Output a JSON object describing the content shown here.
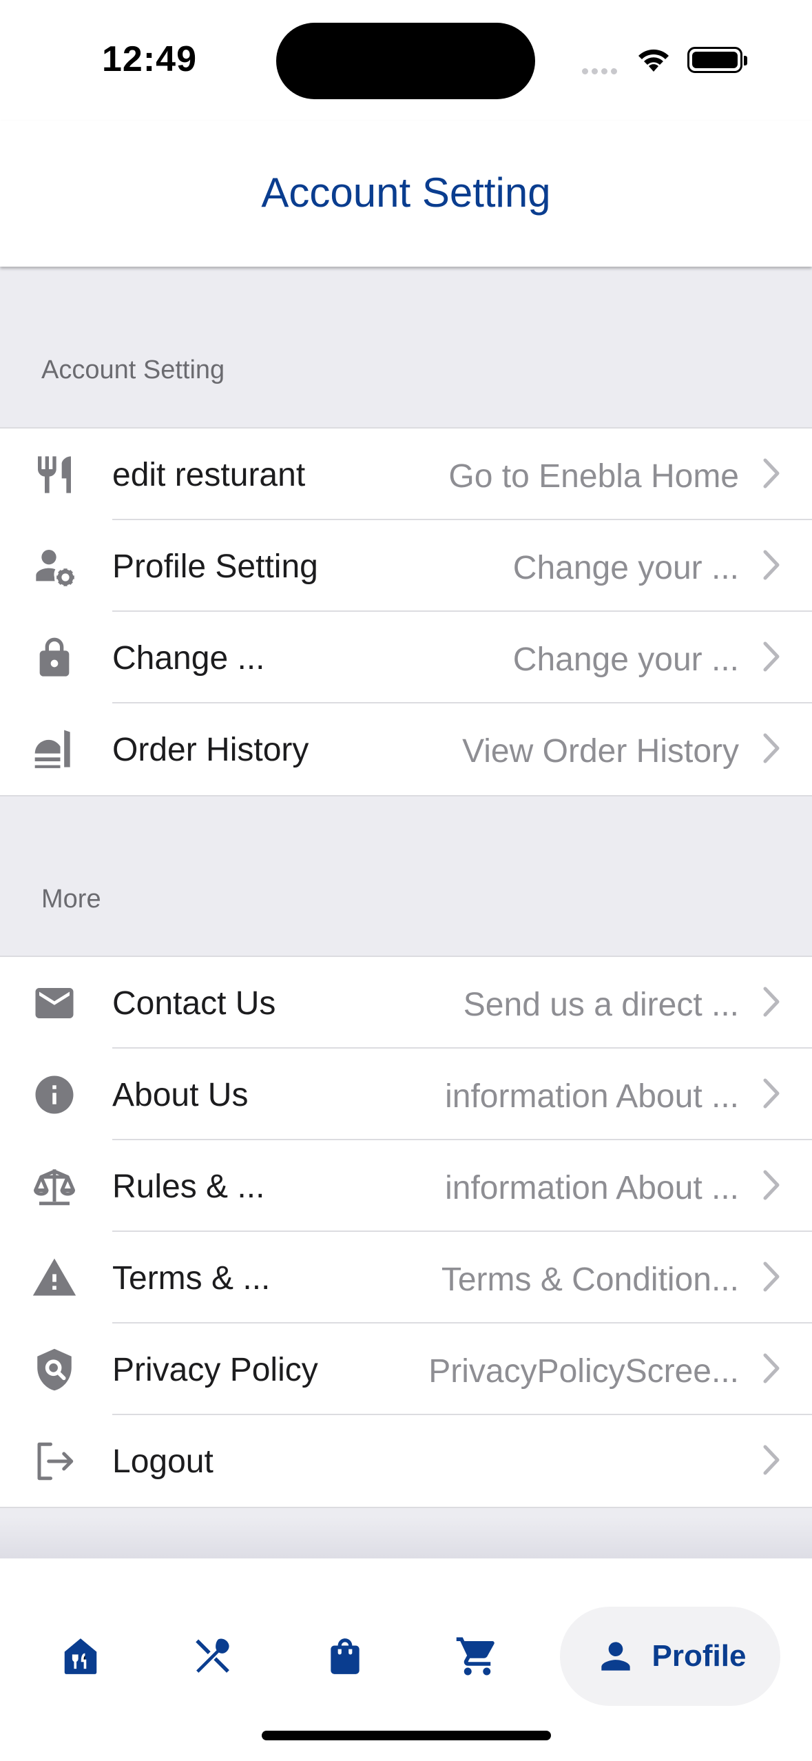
{
  "status_bar": {
    "time": "12:49"
  },
  "header": {
    "title": "Account Setting"
  },
  "sections": [
    {
      "title": "Account Setting",
      "items": [
        {
          "icon": "fork-knife-icon",
          "label": "edit resturant",
          "detail": "Go to Enebla Home"
        },
        {
          "icon": "user-gear-icon",
          "label": "Profile Setting",
          "detail": "Change your ..."
        },
        {
          "icon": "lock-icon",
          "label": "Change ...",
          "detail": "Change your ..."
        },
        {
          "icon": "food-bell-icon",
          "label": "Order History",
          "detail": "View Order History"
        }
      ]
    },
    {
      "title": "More",
      "items": [
        {
          "icon": "mail-icon",
          "label": "Contact Us",
          "detail": "Send us a direct ..."
        },
        {
          "icon": "info-icon",
          "label": "About Us",
          "detail": "information About ..."
        },
        {
          "icon": "scale-icon",
          "label": "Rules & ...",
          "detail": "information About ..."
        },
        {
          "icon": "warning-icon",
          "label": "Terms & ...",
          "detail": "Terms & Condition..."
        },
        {
          "icon": "shield-search-icon",
          "label": "Privacy Policy",
          "detail": "PrivacyPolicyScree..."
        },
        {
          "icon": "logout-icon",
          "label": "Logout",
          "detail": ""
        }
      ]
    }
  ],
  "tab_bar": {
    "tabs": [
      {
        "icon": "restaurant-home-icon",
        "label": ""
      },
      {
        "icon": "utensils-icon",
        "label": ""
      },
      {
        "icon": "shopping-bag-icon",
        "label": ""
      },
      {
        "icon": "cart-icon",
        "label": ""
      },
      {
        "icon": "person-icon",
        "label": "Profile",
        "active": true
      }
    ]
  },
  "colors": {
    "accent": "#0a3d8f",
    "icon_gray": "#7a7a7f",
    "background": "#ececf1"
  }
}
